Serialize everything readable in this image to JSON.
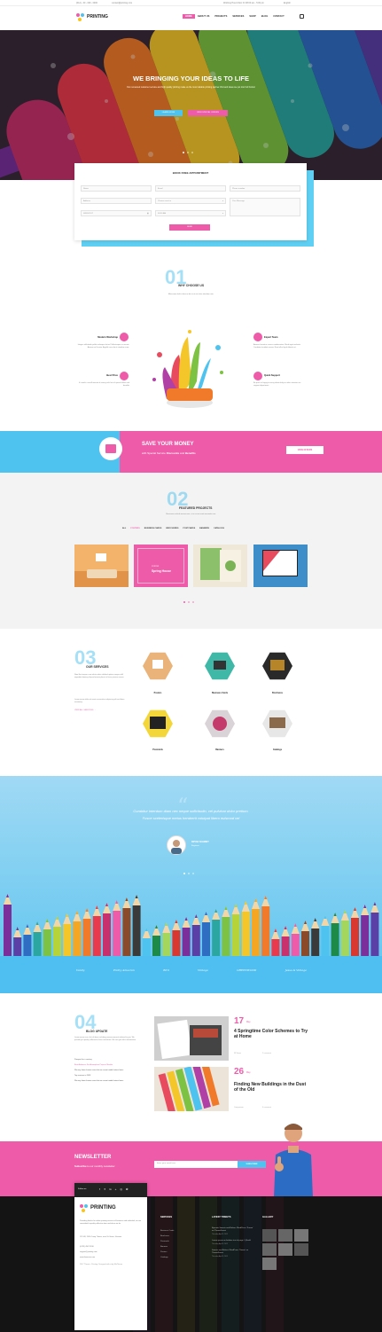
{
  "topbar": {
    "phone": "(012) - 00 - 000 - 0000",
    "email": "contact@printing.com",
    "hours": "Working Hours Mon Fri 08:00 am - 5:00 pm",
    "language": "English"
  },
  "brand": {
    "name": "PRINTING"
  },
  "menu": [
    "HOME",
    "ABOUT US",
    "PROJECTS",
    "SERVICES",
    "SHOP",
    "BLOG",
    "CONTACT"
  ],
  "hero": {
    "title": "WE BRINGING YOUR IDEAS TO LIFE",
    "subtitle": "Our renowned customer service and high quality printing make us the most reliable printing partner.Visit and ideas we put into Full Colour",
    "btn_learn": "LEARN MORE",
    "btn_offers": "VIEW SPECIAL OFFERS"
  },
  "appointment": {
    "title": "BOOK FREE APPOINTMENT",
    "name_ph": "Name",
    "email_ph": "Email",
    "phone_ph": "Phone number",
    "address_ph": "Address",
    "service_ph": "Choose service",
    "message_ph": "Your Message",
    "date_val": "08/05/2017",
    "time_val": "09:30 AM",
    "send": "SEND"
  },
  "why": {
    "num": "01",
    "title": "WHY CHOOSE US",
    "sub": "Maecenas dolcis rhoncus dui ut at nisi vitae interdum non.",
    "items": [
      {
        "title": "Modern Workshop",
        "text": "Integer sollicitudin pellet malesque lectus Pellentesque ac mauris. Aenean vel lacinia. Aiguilla ceus do et interdum nunc."
      },
      {
        "title": "Best Price",
        "text": "It's worth a small amount of money with lots of special offers and benefits"
      },
      {
        "title": "Expert Team",
        "text": "Aenean fraeretus cursus condimentum. Morbi eget molestie. Curabitur tincidunt massa. Nam tellus ligula lobortis ut."
      },
      {
        "title": "Quick Support",
        "text": "Be quick to happy to worry about delay or other situation our support department"
      }
    ]
  },
  "save": {
    "title": "SAVE YOUR MONEY",
    "sub_pre": "with Special Service ",
    "sub_b1": "Discounts",
    "sub_and": " and ",
    "sub_b2": "Benefits",
    "btn": "VIEW OFFERS"
  },
  "projects": {
    "num": "02",
    "title": "FEATURED PROJECTS",
    "sub": "Maecenas vehicle massa nunc, in a cursus enet venenatis non.",
    "tabs": [
      "ALL",
      "POSTERS",
      "BUSINESS CARDS",
      "BROCHURES",
      "POSTCARDS",
      "BANNERS",
      "CATALOGS"
    ],
    "featured_cat": "POSTER",
    "featured_title": "Spring House"
  },
  "services": {
    "num": "03",
    "title": "OUR SERVICES",
    "text": "Nam libe tempor cum soluta nobis eleifend option congue nihil imperdiet doming id quod mazim placat ut facer possim assum.",
    "text2": "Lorem ipsum dolor sit amet consectetur adipiscing elit sed diam nonummy.",
    "link": "VIEW ALL SERVICES →",
    "items": [
      "Posters",
      "Business Cards",
      "Brochures",
      "Postcards",
      "Banners",
      "Catalogs"
    ]
  },
  "testimonial": {
    "quote1": "Curabitur interdum diam nec neque sollicitudin, vel pulvinar dolor pretium.",
    "quote2": "Fusce scelerisque metus hendrerit volutpat libero euismod vel",
    "name": "BRYAN SCHMIDT",
    "role": "Engineer"
  },
  "brands": [
    "Vanity",
    "Pretty Ameeran",
    "Bird",
    "Vintage",
    "GREENWOOD",
    "Jesus & Vintage"
  ],
  "blog": {
    "num": "04",
    "title": "BLOG UPDATE",
    "intro": "Lorem ipsum are a list of ideas including announcements tailored to you. We provide you quality reflected in lines and whole. We can give other information.",
    "list": [
      "Prospect for a century",
      "Best Ambience For Atmosphere Projects Module",
      "We may know human users but we cannot model natural ones",
      "Top services in 2018",
      "We may know human users but we cannot model natural ones"
    ],
    "posts": [
      {
        "day": "17",
        "month": "May",
        "title": "4 Springtime Color Schemes to Try at Home",
        "views": "38 Views",
        "comments": "2 comment"
      },
      {
        "day": "26",
        "month": "May",
        "title": "Finding New Buildings in the Dust of the Old",
        "views": "Comparison",
        "comments": "4 comment"
      }
    ]
  },
  "newsletter": {
    "title": "NEWSLETTER",
    "sub": "Subscribe",
    "sub2": " to our monthly newsletter",
    "email_ph": "Enter your email here",
    "btn": "SUBSCRIBE"
  },
  "footer": {
    "follow": "Follow us:",
    "brand": "PRINTING",
    "about": "Providing thanks for online printing services of business and individual, we are committed to quality reflection time and when we do.",
    "address": "123 UK, 2016 Camp Thoma, near St. Ibarra, Vietnam",
    "phone": "(0123) 4567 8910",
    "email": "support@printing.com",
    "web": "www.themenix.com",
    "copy": "2017 Themix - Printing. Designed with ♥ by MixTheme",
    "col_services": "SERVICES",
    "services": [
      "Business Cards",
      "Brochures",
      "Postcards",
      "Banners",
      "Posters",
      "Catalogs"
    ],
    "col_tweets": "LATEST TWEETS",
    "tweets": [
      {
        "text": "Bysnote Sweets and Bakers WordPress Theme' on ThemeForest",
        "time": "Thursday April 8, 2015"
      },
      {
        "text": "Lorem ipsum on bebitae text of page / @bold",
        "time": "Thursday April 8, 2015"
      },
      {
        "text": "Sweets and Bakers WordPress Theme' on ThemeForest",
        "time": "Thursday April 8, 2015"
      }
    ],
    "col_gallery": "GALLERY"
  },
  "colors": {
    "pink": "#ee5ca9",
    "blue": "#4fc3f0"
  }
}
